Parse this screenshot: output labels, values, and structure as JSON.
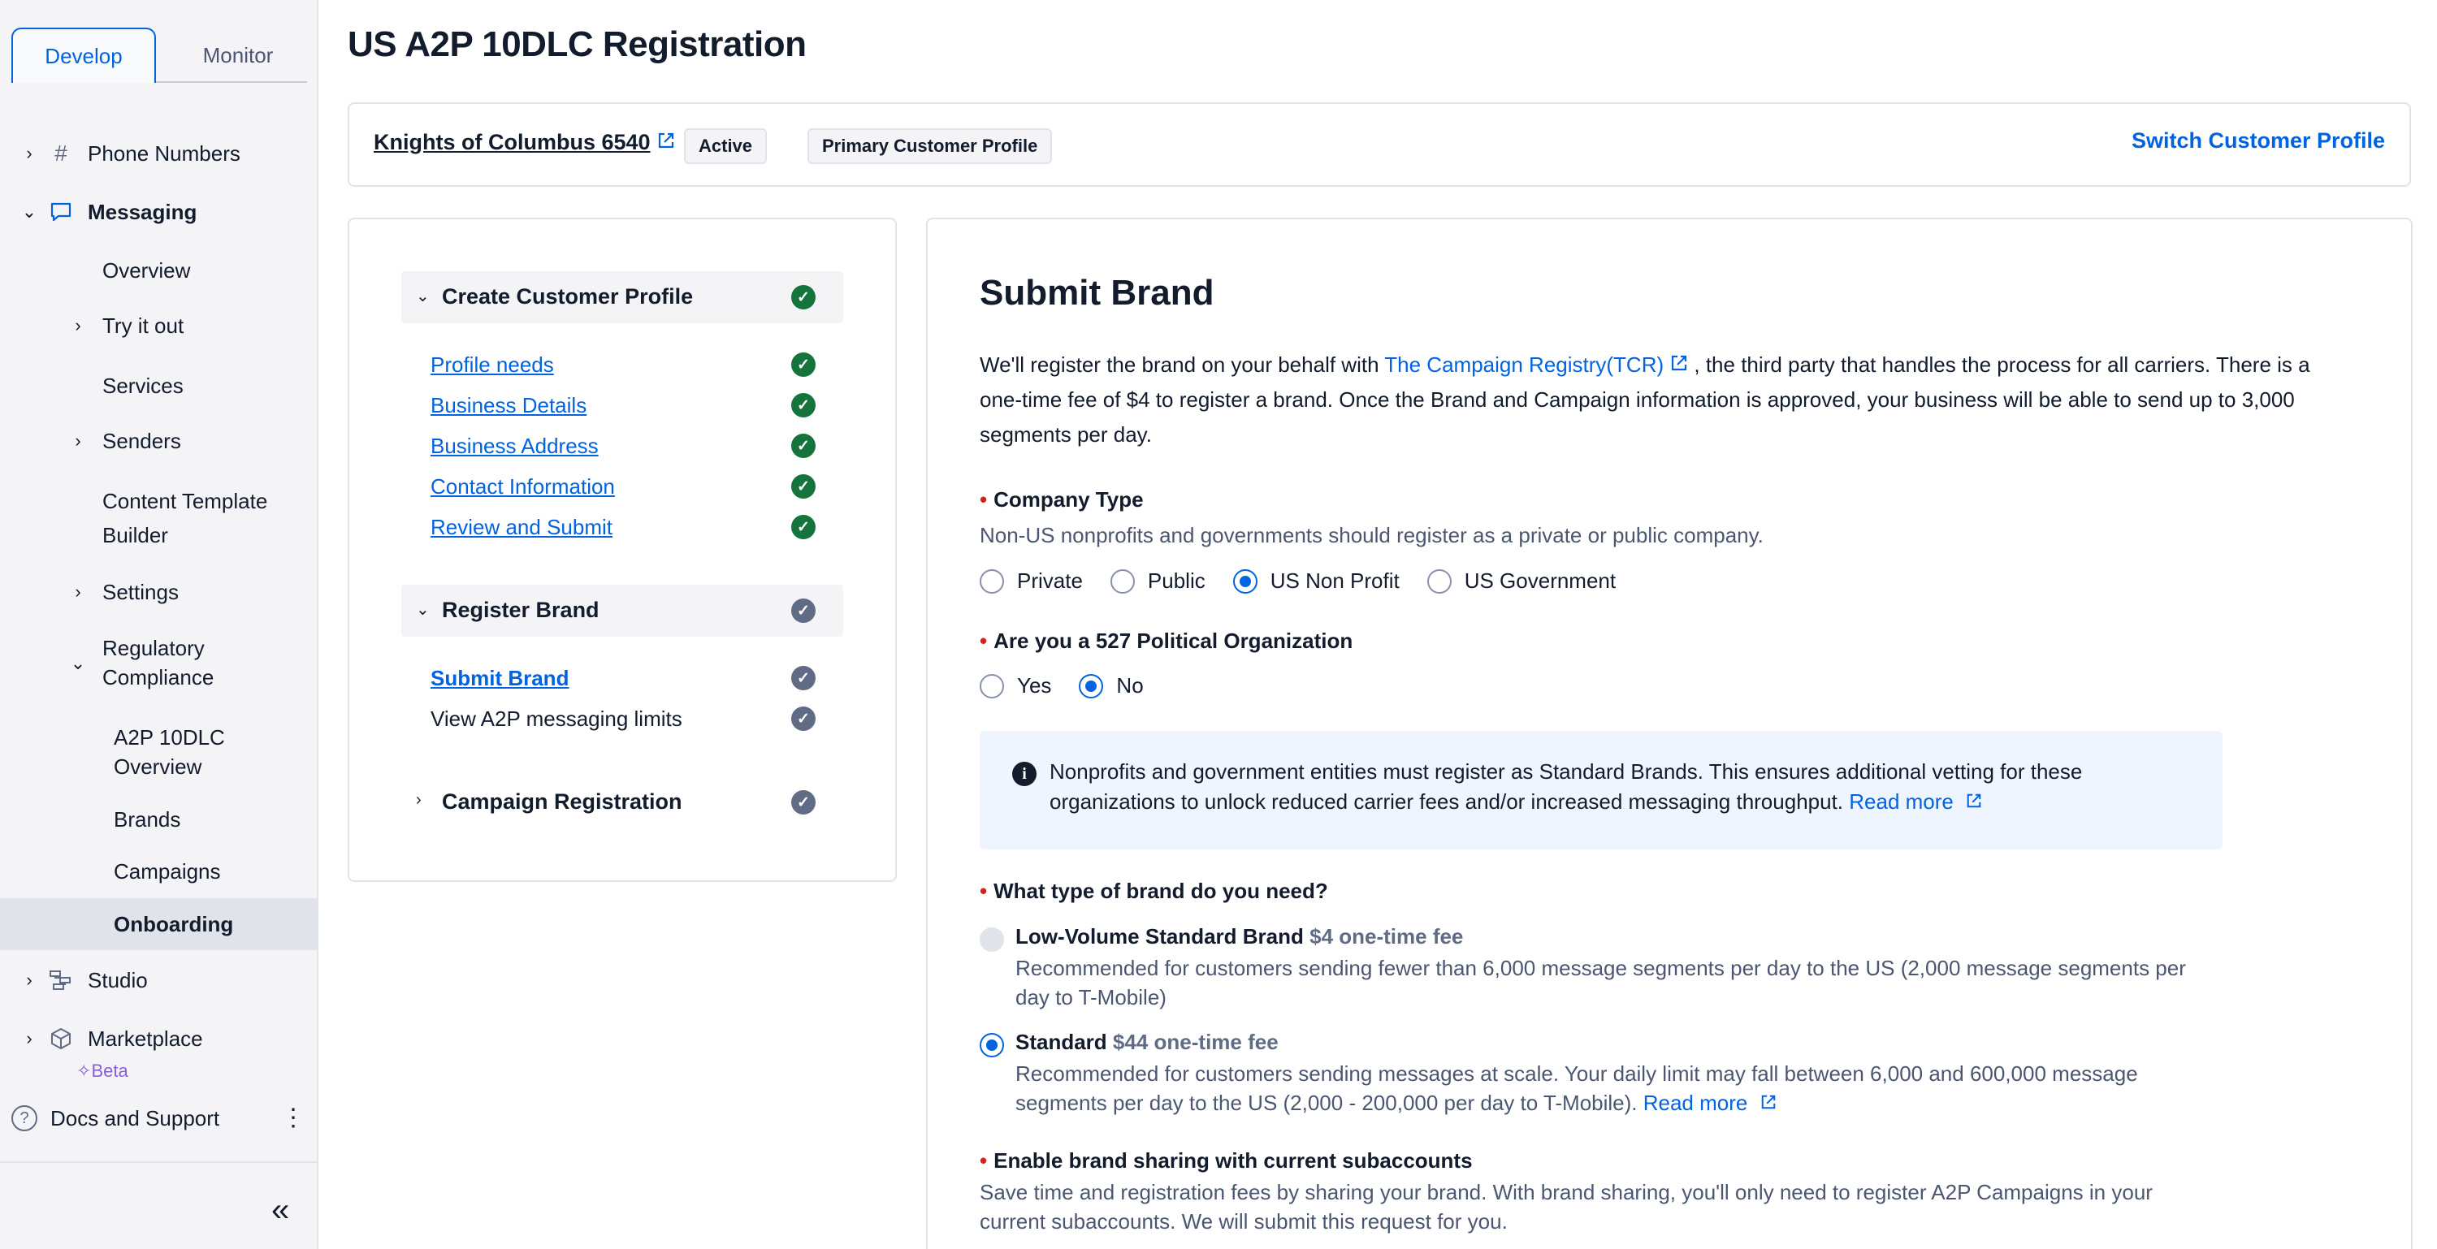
{
  "sidebar": {
    "tabs": {
      "develop": "Develop",
      "monitor": "Monitor"
    },
    "items": {
      "phone_numbers": "Phone Numbers",
      "messaging": "Messaging",
      "overview": "Overview",
      "try_it_out": "Try it out",
      "services": "Services",
      "senders": "Senders",
      "content_template_1": "Content Template",
      "content_template_2": "Builder",
      "settings": "Settings",
      "regulatory_1": "Regulatory",
      "regulatory_2": "Compliance",
      "a2p_1": "A2P 10DLC",
      "a2p_2": "Overview",
      "brands": "Brands",
      "campaigns": "Campaigns",
      "onboarding": "Onboarding",
      "studio": "Studio",
      "marketplace": "Marketplace",
      "beta": "Beta"
    },
    "docs": "Docs and Support"
  },
  "page": {
    "title": "US A2P 10DLC Registration"
  },
  "profile": {
    "name": "Knights of Columbus 6540",
    "status_badge": "Active",
    "type_badge": "Primary Customer Profile",
    "switch_label": "Switch Customer Profile"
  },
  "steps": {
    "group1": {
      "title": "Create Customer Profile",
      "items": [
        "Profile needs",
        "Business Details",
        "Business Address",
        "Contact Information",
        "Review and Submit"
      ]
    },
    "group2": {
      "title": "Register Brand",
      "items": [
        "Submit Brand",
        "View A2P messaging limits"
      ]
    },
    "group3": {
      "title": "Campaign Registration"
    }
  },
  "form": {
    "title": "Submit Brand",
    "intro_1": "We'll register the brand on your behalf with ",
    "intro_link": "The Campaign Registry(TCR)",
    "intro_2": ", the third party that handles the process for all carriers. There is a one-time fee of $4 to register a brand. Once the Brand and Campaign information is approved, your business will be able to send up to 3,000 segments per day.",
    "company_type": {
      "label": "Company Type",
      "help": "Non-US nonprofits and governments should register as a private or public company.",
      "options": [
        "Private",
        "Public",
        "US Non Profit",
        "US Government"
      ],
      "selected": "US Non Profit"
    },
    "political": {
      "label": "Are you a 527 Political Organization",
      "options": [
        "Yes",
        "No"
      ],
      "selected": "No"
    },
    "info": {
      "text": "Nonprofits and government entities must register as Standard Brands. This ensures additional vetting for these organizations to unlock reduced carrier fees and/or increased messaging throughput. ",
      "link": "Read more"
    },
    "brand_type": {
      "label": "What type of brand do you need?",
      "low_volume": {
        "title": "Low-Volume Standard Brand ",
        "fee": "$4 one-time fee",
        "desc": "Recommended for customers sending fewer than 6,000 message segments per day to the US (2,000 message segments per day to T-Mobile)"
      },
      "standard": {
        "title": "Standard ",
        "fee": "$44 one-time fee",
        "desc": "Recommended for customers sending messages at scale. Your daily limit may fall between 6,000 and 600,000 message segments per day to the US (2,000 - 200,000 per day to T-Mobile). ",
        "link": "Read more"
      },
      "selected": "Standard"
    },
    "sharing": {
      "label": "Enable brand sharing with current subaccounts",
      "help": "Save time and registration fees by sharing your brand. With brand sharing, you'll only need to register A2P Campaigns in your current subaccounts. We will submit this request for you."
    }
  },
  "colors": {
    "accent": "#0263e0",
    "success": "#14743c",
    "required": "#d61f1f"
  }
}
